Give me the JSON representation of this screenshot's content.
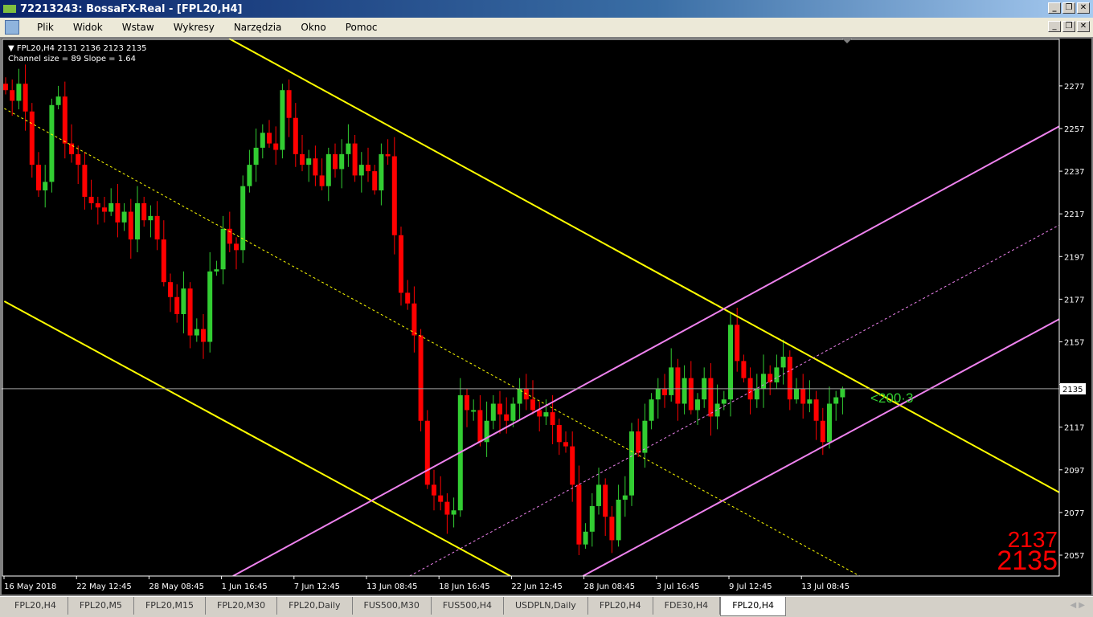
{
  "window": {
    "title": "72213243: BossaFX-Real - [FPL20,H4]",
    "logo": "FX"
  },
  "menu": [
    "Plik",
    "Widok",
    "Wstaw",
    "Wykresy",
    "Narzędzia",
    "Okno",
    "Pomoc"
  ],
  "chart_info": {
    "header": "FPL20,H4  2131 2136 2123 2135",
    "channel": "Channel size = 89 Slope = 1.64"
  },
  "tabs": [
    {
      "label": "FPL20,H4"
    },
    {
      "label": "FPL20,M5"
    },
    {
      "label": "FPL20,M15"
    },
    {
      "label": "FPL20,M30"
    },
    {
      "label": "FPL20,Daily"
    },
    {
      "label": "FUS500,M30"
    },
    {
      "label": "FUS500,H4"
    },
    {
      "label": "USDPLN,Daily"
    },
    {
      "label": "FPL20,H4"
    },
    {
      "label": "FDE30,H4"
    },
    {
      "label": "FPL20,H4",
      "active": true
    }
  ],
  "chart_data": {
    "type": "candlestick",
    "symbol": "FPL20",
    "timeframe": "H4",
    "ylim": [
      2047,
      2299
    ],
    "y_ticks": [
      2277,
      2257,
      2237,
      2217,
      2197,
      2177,
      2157,
      2137,
      2117,
      2097,
      2077,
      2057
    ],
    "current_price": 2135,
    "x_ticks": [
      {
        "bar": 0,
        "label": "16 May 2018"
      },
      {
        "bar": 11,
        "label": "22 May 12:45"
      },
      {
        "bar": 22,
        "label": "28 May 08:45"
      },
      {
        "bar": 33,
        "label": "1 Jun 16:45"
      },
      {
        "bar": 44,
        "label": "7 Jun 12:45"
      },
      {
        "bar": 55,
        "label": "13 Jun 08:45"
      },
      {
        "bar": 66,
        "label": "18 Jun 16:45"
      },
      {
        "bar": 77,
        "label": "22 Jun 12:45"
      },
      {
        "bar": 88,
        "label": "28 Jun 08:45"
      },
      {
        "bar": 99,
        "label": "3 Jul 16:45"
      },
      {
        "bar": 110,
        "label": "9 Jul 12:45"
      },
      {
        "bar": 121,
        "label": "13 Jul 08:45"
      }
    ],
    "closes": [
      2275,
      2270,
      2278,
      2265,
      2240,
      2228,
      2232,
      2268,
      2272,
      2250,
      2245,
      2240,
      2225,
      2222,
      2220,
      2218,
      2222,
      2213,
      2218,
      2205,
      2222,
      2214,
      2216,
      2205,
      2185,
      2178,
      2170,
      2182,
      2160,
      2163,
      2157,
      2190,
      2191,
      2210,
      2203,
      2200,
      2230,
      2240,
      2248,
      2255,
      2250,
      2247,
      2275,
      2262,
      2245,
      2240,
      2243,
      2235,
      2230,
      2245,
      2238,
      2245,
      2250,
      2235,
      2240,
      2237,
      2228,
      2245,
      2244,
      2207,
      2180,
      2175,
      2160,
      2120,
      2090,
      2085,
      2082,
      2076,
      2078,
      2132,
      2125,
      2125,
      2110,
      2120,
      2128,
      2123,
      2120,
      2128,
      2135,
      2130,
      2125,
      2122,
      2124,
      2118,
      2110,
      2108,
      2090,
      2062,
      2068,
      2080,
      2090,
      2075,
      2064,
      2083,
      2085,
      2115,
      2105,
      2120,
      2130,
      2135,
      2132,
      2145,
      2128,
      2140,
      2125,
      2130,
      2140,
      2122,
      2128,
      2130,
      2165,
      2148,
      2140,
      2130,
      2135,
      2142,
      2138,
      2145,
      2150,
      2130,
      2135,
      2128,
      2130,
      2120,
      2110,
      2128,
      2131,
      2135
    ],
    "last_bar": {
      "open": 2131,
      "high": 2136,
      "low": 2123,
      "close": 2135
    },
    "lines": [
      {
        "name": "yellow-channel-upper",
        "color": "#ffff00",
        "style": "solid",
        "from": [
          33.9,
          2299.2
        ],
        "to": [
          159.9,
          2086.4
        ]
      },
      {
        "name": "yellow-channel-lower",
        "color": "#ffff00",
        "style": "solid",
        "from": [
          -0.2,
          2176
        ],
        "to": [
          76.6,
          2047.2
        ]
      },
      {
        "name": "yellow-channel-middle",
        "color": "#ffff00",
        "style": "dotted",
        "from": [
          -0.2,
          2266.4
        ],
        "to": [
          129.6,
          2047.2
        ]
      },
      {
        "name": "pink-channel-upper",
        "color": "#ee82ee",
        "style": "solid",
        "from": [
          34.5,
          2047.2
        ],
        "to": [
          159.9,
          2258.1
        ]
      },
      {
        "name": "pink-channel-lower",
        "color": "#ee82ee",
        "style": "solid",
        "from": [
          87.6,
          2047.2
        ],
        "to": [
          159.9,
          2167.7
        ]
      },
      {
        "name": "pink-channel-middle",
        "color": "#ee82ee",
        "style": "dotted",
        "from": [
          61.3,
          2047.2
        ],
        "to": [
          159.9,
          2211.8
        ]
      }
    ],
    "annotation": "<200·3",
    "bid_ask": {
      "ask": "2137",
      "bid": "2135"
    },
    "colors": {
      "bull": "#32cd32",
      "bear": "#ff0000",
      "axis": "#ffffff"
    }
  }
}
